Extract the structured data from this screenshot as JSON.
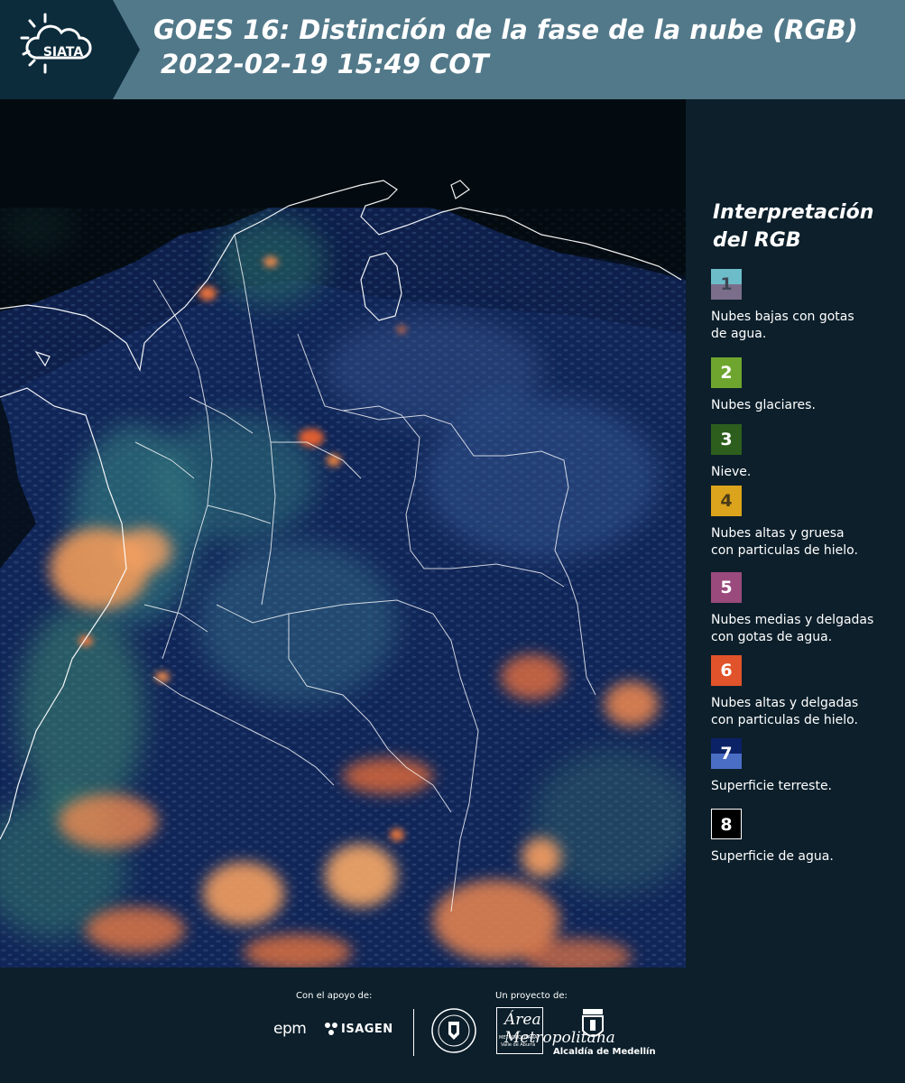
{
  "header": {
    "logo_text": "SIATA",
    "title_line1": "GOES 16: Distinción de la fase de la nube (RGB)",
    "title_line2": "2022-02-19 15:49 COT"
  },
  "legend": {
    "title_line1": "Interpretación",
    "title_line2": "del RGB",
    "items": [
      {
        "number": "1",
        "label_1": "Nubes bajas con gotas",
        "label_2": "de agua.",
        "color_top": "#6cbdc9",
        "color_bottom": "#7b6e8a",
        "text_color": "#3d4553"
      },
      {
        "number": "2",
        "label_1": "Nubes glaciares.",
        "label_2": "",
        "color_top": "#6ea52f",
        "color_bottom": "#6ea52f",
        "text_color": "#ffffff"
      },
      {
        "number": "3",
        "label_1": "Nieve.",
        "label_2": "",
        "color_top": "#2d5e1e",
        "color_bottom": "#2d5e1e",
        "text_color": "#ffffff"
      },
      {
        "number": "4",
        "label_1": "Nubes altas y gruesa",
        "label_2": "con particulas de hielo.",
        "color_top": "#dca41c",
        "color_bottom": "#dca41c",
        "text_color": "#4a3c18"
      },
      {
        "number": "5",
        "label_1": "Nubes medias y delgadas",
        "label_2": "con gotas de agua.",
        "color_top": "#9a4a7c",
        "color_bottom": "#9a4a7c",
        "text_color": "#ffffff"
      },
      {
        "number": "6",
        "label_1": "Nubes altas y delgadas",
        "label_2": "con particulas de hielo.",
        "color_top": "#e1532a",
        "color_bottom": "#e1532a",
        "text_color": "#ffffff"
      },
      {
        "number": "7",
        "label_1": "Superficie terreste.",
        "label_2": "",
        "color_top": "#0b2266",
        "color_bottom": "#4a6ec4",
        "text_color": "#ffffff"
      },
      {
        "number": "8",
        "label_1": "Superficie de agua.",
        "label_2": "",
        "color_top": "#000000",
        "color_bottom": "#000000",
        "text_color": "#ffffff"
      }
    ]
  },
  "footer": {
    "support_label": "Con el apoyo de:",
    "project_label": "Un proyecto de:",
    "sponsors": [
      "epm",
      "ISAGEN"
    ],
    "partners": [
      "Área Metropolitana",
      "Alcaldía de Medellín"
    ],
    "area_small": "METROPOLITANA",
    "area_small2": "Valle de Aburrá"
  },
  "colors": {
    "header_bg": "#52798a",
    "panel_bg": "#0c1f2b",
    "map_bg": "#050d12"
  }
}
